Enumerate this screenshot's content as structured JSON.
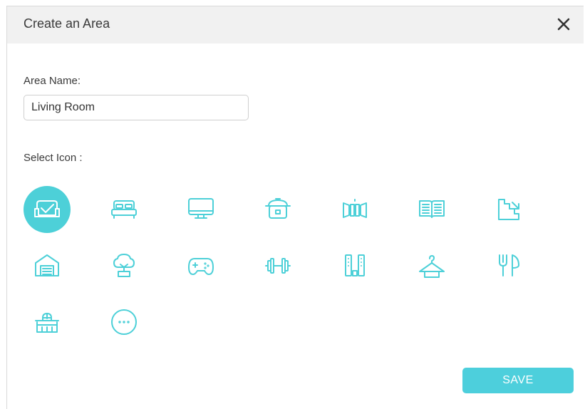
{
  "dialog": {
    "title": "Create an Area",
    "close_icon": "close-icon"
  },
  "form": {
    "area_name_label": "Area Name:",
    "area_name_value": "Living Room",
    "select_icon_label": "Select Icon :"
  },
  "icons": [
    {
      "name": "sofa-icon",
      "selected": true
    },
    {
      "name": "bed-icon",
      "selected": false
    },
    {
      "name": "monitor-icon",
      "selected": false
    },
    {
      "name": "rice-cooker-icon",
      "selected": false
    },
    {
      "name": "door-sensor-icon",
      "selected": false
    },
    {
      "name": "book-icon",
      "selected": false
    },
    {
      "name": "stairs-icon",
      "selected": false
    },
    {
      "name": "garage-icon",
      "selected": false
    },
    {
      "name": "tree-icon",
      "selected": false
    },
    {
      "name": "gamepad-icon",
      "selected": false
    },
    {
      "name": "dumbbell-icon",
      "selected": false
    },
    {
      "name": "speakers-icon",
      "selected": false
    },
    {
      "name": "hanger-icon",
      "selected": false
    },
    {
      "name": "dining-icon",
      "selected": false
    },
    {
      "name": "crib-icon",
      "selected": false
    },
    {
      "name": "more-icon",
      "selected": false
    }
  ],
  "footer": {
    "save_label": "SAVE"
  },
  "colors": {
    "accent": "#4dd0d8",
    "header_bg": "#f1f1f1",
    "save_button": "#4dcfdc"
  }
}
